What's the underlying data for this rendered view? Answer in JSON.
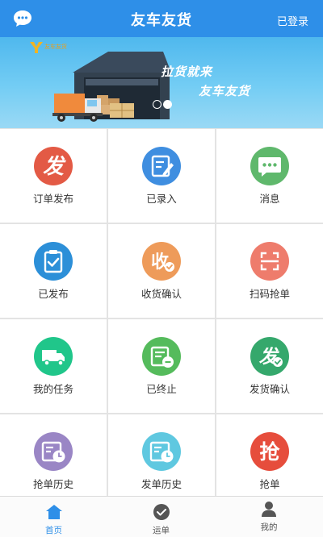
{
  "header": {
    "title": "友车友货",
    "login_label": "已登录",
    "chat_icon": "chat-bubble-icon"
  },
  "banner": {
    "logo_text": "友车友货",
    "slogan_line1": "拉货就来",
    "slogan_line2": "友车友货",
    "slide_count": 2,
    "active_slide": 2
  },
  "menu": [
    {
      "label": "订单发布",
      "icon": "fa-char-icon",
      "color": "#e35a45"
    },
    {
      "label": "已录入",
      "icon": "edit-note-icon",
      "color": "#3f8ee0"
    },
    {
      "label": "消息",
      "icon": "message-dots-icon",
      "color": "#5fb86c"
    },
    {
      "label": "已发布",
      "icon": "clipboard-check-icon",
      "color": "#2c8fd8"
    },
    {
      "label": "收货确认",
      "icon": "shou-check-icon",
      "color": "#ee9b5a"
    },
    {
      "label": "扫码抢单",
      "icon": "scan-icon",
      "color": "#ee7c6c"
    },
    {
      "label": "我的任务",
      "icon": "truck-icon",
      "color": "#20c68a"
    },
    {
      "label": "已终止",
      "icon": "stop-list-icon",
      "color": "#55bb5c"
    },
    {
      "label": "发货确认",
      "icon": "fa-check-icon",
      "color": "#35a86c"
    },
    {
      "label": "抢单历史",
      "icon": "history-clock-icon",
      "color": "#9a86c5"
    },
    {
      "label": "发单历史",
      "icon": "history-list-icon",
      "color": "#5fc8e0"
    },
    {
      "label": "抢单",
      "icon": "qiang-char-icon",
      "color": "#e64d3c"
    }
  ],
  "tabs": [
    {
      "label": "首页",
      "icon": "home-icon",
      "active": true
    },
    {
      "label": "运单",
      "icon": "check-circle-icon",
      "active": false
    },
    {
      "label": "我的",
      "icon": "user-icon",
      "active": false
    }
  ],
  "colors": {
    "header_bg": "#2e8fe8",
    "active_tab": "#2e8fe8"
  }
}
